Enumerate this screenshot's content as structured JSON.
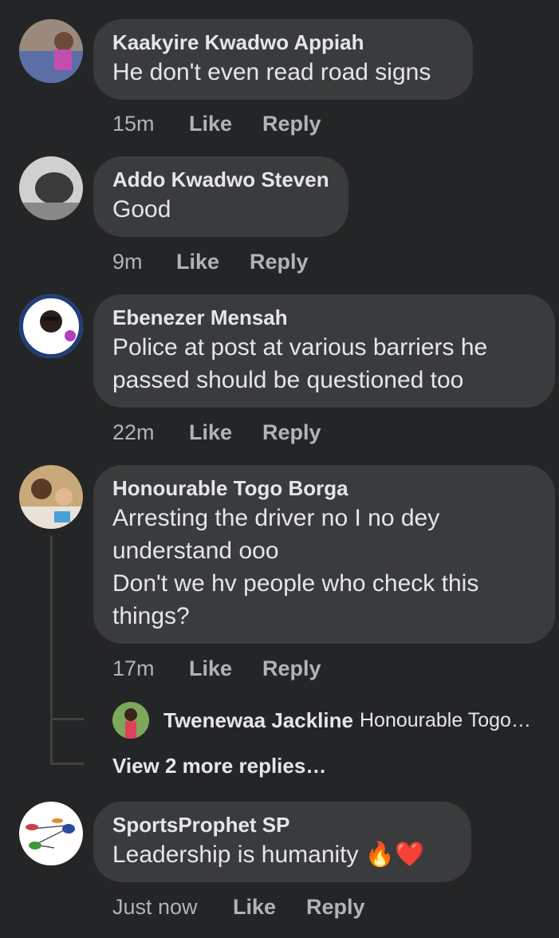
{
  "colors": {
    "background": "#242526",
    "bubble": "#3a3b3c",
    "meta_text": "#b0b3b8",
    "primary_text": "#e4e6eb"
  },
  "comments": [
    {
      "author": "Kaakyire Kwadwo Appiah",
      "text": "He don't even read road signs",
      "time": "15m",
      "like": "Like",
      "reply": "Reply"
    },
    {
      "author": "Addo Kwadwo Steven",
      "text": "Good",
      "time": "9m",
      "like": "Like",
      "reply": "Reply"
    },
    {
      "author": "Ebenezer Mensah",
      "text": "Police at post at various barriers he\npassed should be questioned too",
      "time": "22m",
      "like": "Like",
      "reply": "Reply"
    },
    {
      "author": "Honourable Togo Borga",
      "text": "Arresting the driver no I no dey\nunderstand ooo\nDon't we hv people who check this\nthings?",
      "time": "17m",
      "like": "Like",
      "reply": "Reply",
      "replies": [
        {
          "author": "Twenewaa Jackline",
          "text": "Honourable Togo…"
        }
      ],
      "view_more": "View 2 more replies…"
    },
    {
      "author": "SportsProphet SP",
      "text": "Leadership is humanity",
      "emoji": "🔥❤️",
      "time": "Just now",
      "like": "Like",
      "reply": "Reply"
    }
  ]
}
